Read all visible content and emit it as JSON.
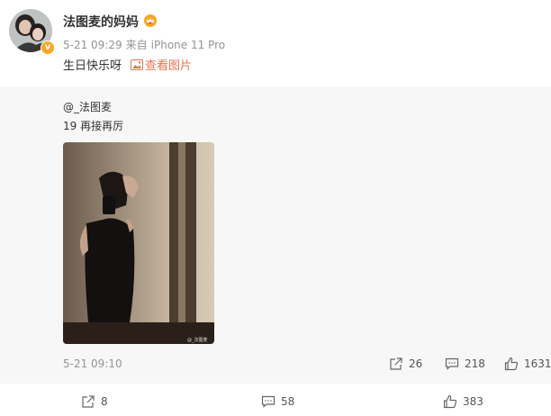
{
  "author": {
    "name": "法图麦的妈妈",
    "verified_badge": "v",
    "crown_icon": "crown-icon"
  },
  "post": {
    "time": "5-21 09:29",
    "source_prefix": "来自",
    "source": "iPhone 11 Pro",
    "text": "生日快乐呀",
    "view_pic_label": "查看图片"
  },
  "repost": {
    "orig_user": "@_法图麦",
    "orig_text": "19 再接再厉",
    "photo_watermark": "@_法图麦",
    "time": "5-21 09:10",
    "reposts": "26",
    "comments": "218",
    "likes": "1631"
  },
  "footer": {
    "reposts": "8",
    "comments": "58",
    "likes": "383"
  },
  "colors": {
    "accent": "#eb7350",
    "muted": "#939393",
    "repost_bg": "#f7f7f7"
  }
}
